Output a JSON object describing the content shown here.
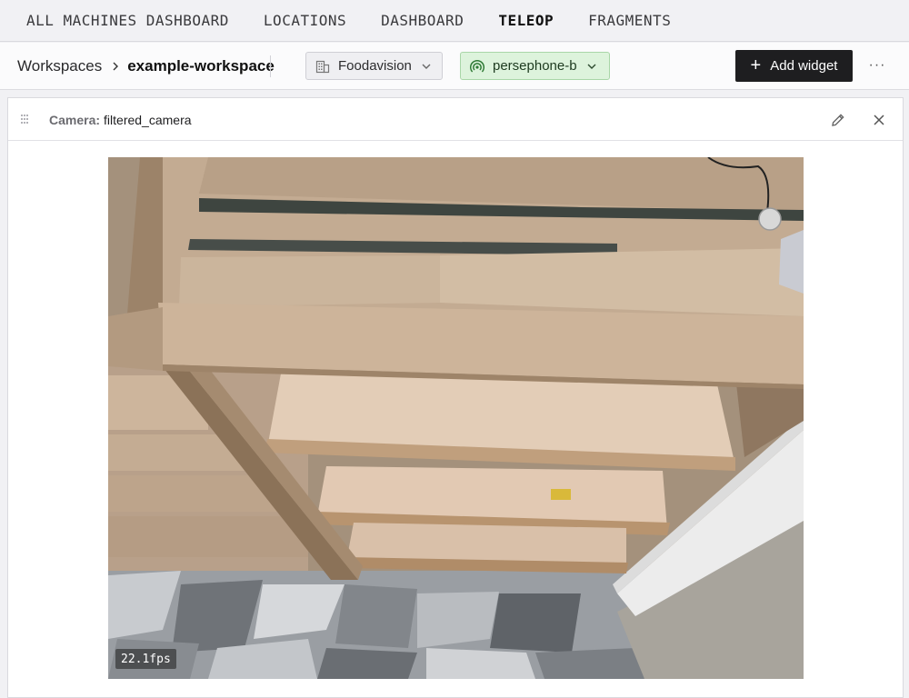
{
  "topnav": {
    "items": [
      {
        "label": "ALL MACHINES DASHBOARD",
        "active": false
      },
      {
        "label": "LOCATIONS",
        "active": false
      },
      {
        "label": "DASHBOARD",
        "active": false
      },
      {
        "label": "TELEOP",
        "active": true
      },
      {
        "label": "FRAGMENTS",
        "active": false
      }
    ]
  },
  "header": {
    "breadcrumb": {
      "root": "Workspaces",
      "current": "example-workspace"
    },
    "org_selector": {
      "value": "Foodavision",
      "icon": "building-icon"
    },
    "machine_selector": {
      "value": "persephone-b",
      "icon": "signal-icon",
      "status_color": "#ddf3dc"
    },
    "add_widget_label": "Add widget",
    "more_label": "···"
  },
  "widget": {
    "title_label": "Camera:",
    "title_value": "filtered_camera",
    "stream": {
      "fps_text": "22.1fps"
    }
  }
}
